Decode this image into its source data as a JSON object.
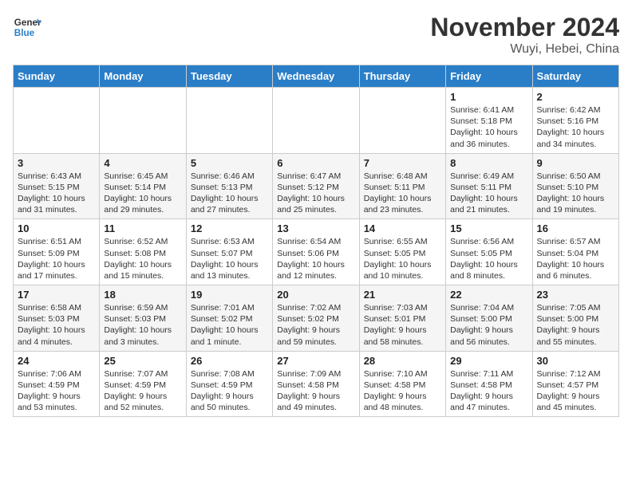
{
  "header": {
    "logo_line1": "General",
    "logo_line2": "Blue",
    "title": "November 2024",
    "subtitle": "Wuyi, Hebei, China"
  },
  "weekdays": [
    "Sunday",
    "Monday",
    "Tuesday",
    "Wednesday",
    "Thursday",
    "Friday",
    "Saturday"
  ],
  "rows": [
    {
      "cells": [
        {
          "day": "",
          "empty": true
        },
        {
          "day": "",
          "empty": true
        },
        {
          "day": "",
          "empty": true
        },
        {
          "day": "",
          "empty": true
        },
        {
          "day": "",
          "empty": true
        },
        {
          "day": "1",
          "info": "Sunrise: 6:41 AM\nSunset: 5:18 PM\nDaylight: 10 hours and 36 minutes."
        },
        {
          "day": "2",
          "info": "Sunrise: 6:42 AM\nSunset: 5:16 PM\nDaylight: 10 hours and 34 minutes."
        }
      ]
    },
    {
      "cells": [
        {
          "day": "3",
          "info": "Sunrise: 6:43 AM\nSunset: 5:15 PM\nDaylight: 10 hours and 31 minutes."
        },
        {
          "day": "4",
          "info": "Sunrise: 6:45 AM\nSunset: 5:14 PM\nDaylight: 10 hours and 29 minutes."
        },
        {
          "day": "5",
          "info": "Sunrise: 6:46 AM\nSunset: 5:13 PM\nDaylight: 10 hours and 27 minutes."
        },
        {
          "day": "6",
          "info": "Sunrise: 6:47 AM\nSunset: 5:12 PM\nDaylight: 10 hours and 25 minutes."
        },
        {
          "day": "7",
          "info": "Sunrise: 6:48 AM\nSunset: 5:11 PM\nDaylight: 10 hours and 23 minutes."
        },
        {
          "day": "8",
          "info": "Sunrise: 6:49 AM\nSunset: 5:11 PM\nDaylight: 10 hours and 21 minutes."
        },
        {
          "day": "9",
          "info": "Sunrise: 6:50 AM\nSunset: 5:10 PM\nDaylight: 10 hours and 19 minutes."
        }
      ]
    },
    {
      "cells": [
        {
          "day": "10",
          "info": "Sunrise: 6:51 AM\nSunset: 5:09 PM\nDaylight: 10 hours and 17 minutes."
        },
        {
          "day": "11",
          "info": "Sunrise: 6:52 AM\nSunset: 5:08 PM\nDaylight: 10 hours and 15 minutes."
        },
        {
          "day": "12",
          "info": "Sunrise: 6:53 AM\nSunset: 5:07 PM\nDaylight: 10 hours and 13 minutes."
        },
        {
          "day": "13",
          "info": "Sunrise: 6:54 AM\nSunset: 5:06 PM\nDaylight: 10 hours and 12 minutes."
        },
        {
          "day": "14",
          "info": "Sunrise: 6:55 AM\nSunset: 5:05 PM\nDaylight: 10 hours and 10 minutes."
        },
        {
          "day": "15",
          "info": "Sunrise: 6:56 AM\nSunset: 5:05 PM\nDaylight: 10 hours and 8 minutes."
        },
        {
          "day": "16",
          "info": "Sunrise: 6:57 AM\nSunset: 5:04 PM\nDaylight: 10 hours and 6 minutes."
        }
      ]
    },
    {
      "cells": [
        {
          "day": "17",
          "info": "Sunrise: 6:58 AM\nSunset: 5:03 PM\nDaylight: 10 hours and 4 minutes."
        },
        {
          "day": "18",
          "info": "Sunrise: 6:59 AM\nSunset: 5:03 PM\nDaylight: 10 hours and 3 minutes."
        },
        {
          "day": "19",
          "info": "Sunrise: 7:01 AM\nSunset: 5:02 PM\nDaylight: 10 hours and 1 minute."
        },
        {
          "day": "20",
          "info": "Sunrise: 7:02 AM\nSunset: 5:02 PM\nDaylight: 9 hours and 59 minutes."
        },
        {
          "day": "21",
          "info": "Sunrise: 7:03 AM\nSunset: 5:01 PM\nDaylight: 9 hours and 58 minutes."
        },
        {
          "day": "22",
          "info": "Sunrise: 7:04 AM\nSunset: 5:00 PM\nDaylight: 9 hours and 56 minutes."
        },
        {
          "day": "23",
          "info": "Sunrise: 7:05 AM\nSunset: 5:00 PM\nDaylight: 9 hours and 55 minutes."
        }
      ]
    },
    {
      "cells": [
        {
          "day": "24",
          "info": "Sunrise: 7:06 AM\nSunset: 4:59 PM\nDaylight: 9 hours and 53 minutes."
        },
        {
          "day": "25",
          "info": "Sunrise: 7:07 AM\nSunset: 4:59 PM\nDaylight: 9 hours and 52 minutes."
        },
        {
          "day": "26",
          "info": "Sunrise: 7:08 AM\nSunset: 4:59 PM\nDaylight: 9 hours and 50 minutes."
        },
        {
          "day": "27",
          "info": "Sunrise: 7:09 AM\nSunset: 4:58 PM\nDaylight: 9 hours and 49 minutes."
        },
        {
          "day": "28",
          "info": "Sunrise: 7:10 AM\nSunset: 4:58 PM\nDaylight: 9 hours and 48 minutes."
        },
        {
          "day": "29",
          "info": "Sunrise: 7:11 AM\nSunset: 4:58 PM\nDaylight: 9 hours and 47 minutes."
        },
        {
          "day": "30",
          "info": "Sunrise: 7:12 AM\nSunset: 4:57 PM\nDaylight: 9 hours and 45 minutes."
        }
      ]
    }
  ]
}
